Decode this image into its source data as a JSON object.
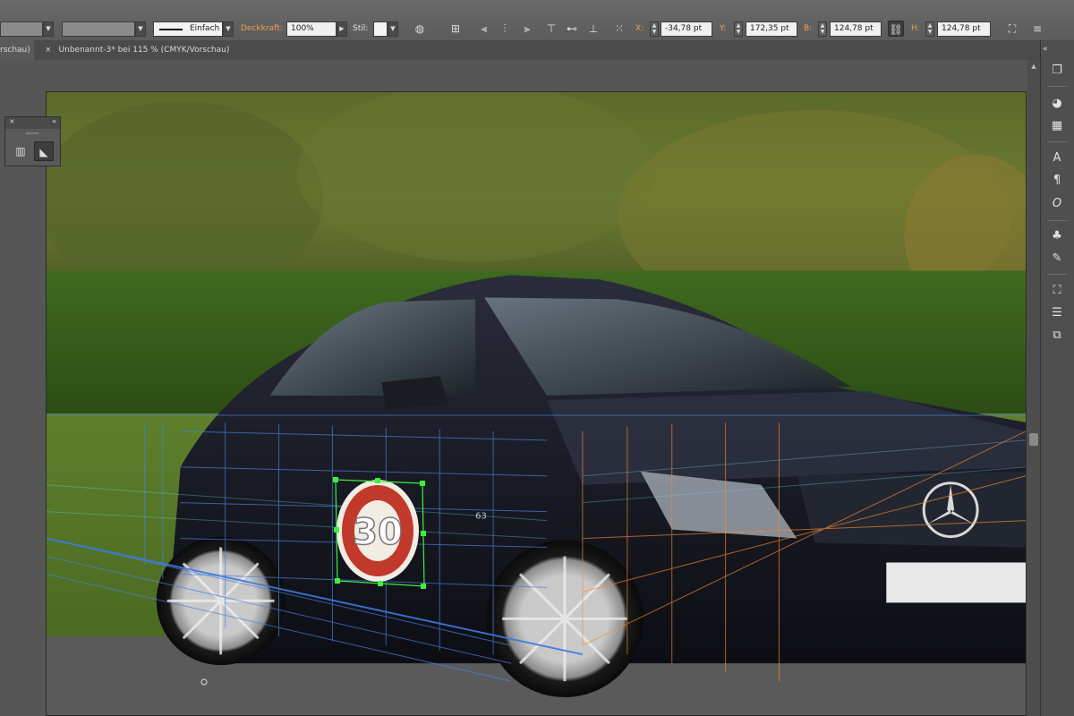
{
  "control_bar": {
    "stroke_style_label": "Einfach",
    "opacity_label": "Deckkraft:",
    "opacity_value": "100%",
    "style_label": "Stil:",
    "x_label": "X:",
    "x_value": "-34,78 pt",
    "y_label": "Y:",
    "y_value": "172,35 pt",
    "w_label": "B:",
    "w_value": "124,78 pt",
    "h_label": "H:",
    "h_value": "124,78 pt"
  },
  "tabs": [
    {
      "label": "rschau)"
    },
    {
      "label": "Unbenannt-3* bei 115 % (CMYK/Vorschau)"
    }
  ],
  "canvas": {
    "car_badge_text": "63",
    "sign_number": "30",
    "colors": {
      "selection": "#3cf03c",
      "grid_blue": "#4a7fe0",
      "grid_orange": "#ff8a2a",
      "sign_red": "#c0392b"
    }
  },
  "icons": {
    "panel": [
      "bar-chart-icon",
      "perspective-selection-icon"
    ],
    "dock": [
      "graphic-styles-icon",
      "color-palette-icon",
      "swatches-grid-icon",
      "character-icon",
      "paragraph-icon",
      "opentype-icon",
      "symbols-icon",
      "brushes-icon",
      "transform-icon",
      "align-icon",
      "pathfinder-icon"
    ]
  }
}
